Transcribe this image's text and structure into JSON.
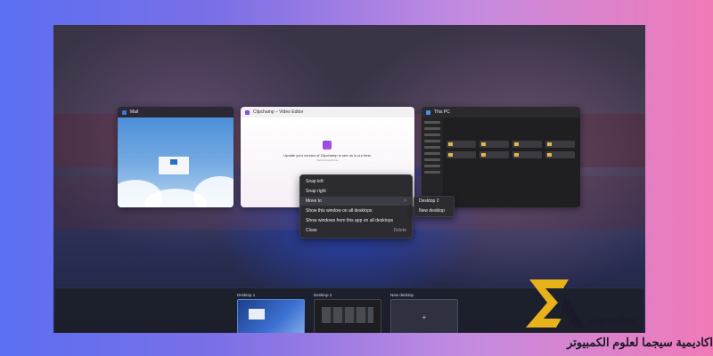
{
  "windows": {
    "mail": {
      "title": "Mail"
    },
    "clipchamp": {
      "title": "Clipchamp – Video Editor",
      "message": "Update your version of Clipchamp to see us in our best.",
      "sub": "Visit microsoft.com"
    },
    "this_pc": {
      "title": "This PC"
    }
  },
  "context_menu": {
    "items": [
      {
        "label": "Snap left",
        "hint": ""
      },
      {
        "label": "Snap right",
        "hint": ""
      },
      {
        "label": "Move to",
        "hint": ">"
      },
      {
        "label": "Show this window on all desktops",
        "hint": ""
      },
      {
        "label": "Show windows from this app on all desktops",
        "hint": ""
      },
      {
        "label": "Close",
        "hint": "Delete"
      }
    ],
    "submenu": [
      "Desktop 2",
      "New desktop"
    ]
  },
  "desktops": [
    {
      "label": "Desktop 1"
    },
    {
      "label": "Desktop 2"
    },
    {
      "label": "New desktop",
      "plus": "+"
    }
  ],
  "branding": {
    "name": "sigma4pc",
    "arabic": "اكاديمية سيجما لعلوم الكمبيوتر",
    "colors": {
      "gold": "#e8b21a",
      "dark": "#1a1a2a"
    }
  },
  "icons": {
    "mail": "mail-icon",
    "clipchamp": "clipchamp-icon",
    "this_pc": "folder-icon",
    "submenu_arrow": "chevron-right-icon",
    "new_desktop": "plus-icon"
  }
}
